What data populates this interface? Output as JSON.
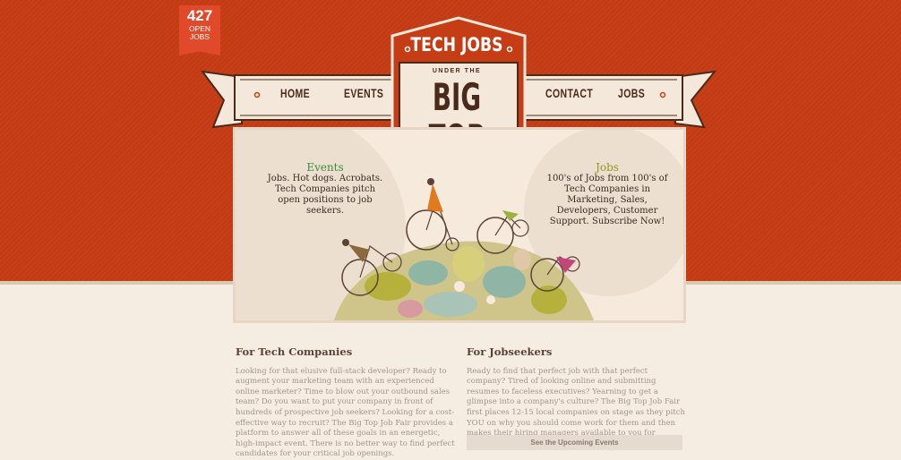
{
  "badge": {
    "count": "427",
    "line1": "OPEN",
    "line2": "JOBS"
  },
  "nav": {
    "home": "HOME",
    "events": "EVENTS",
    "contact": "CONTACT",
    "jobs": "JOBS"
  },
  "logo": {
    "top": "TECH JOBS",
    "middle": "UNDER THE",
    "big": "BIG TOP"
  },
  "hero": {
    "events": {
      "title": "Events",
      "text": "Jobs. Hot dogs. Acrobats. Tech Companies pitch open positions to job seekers."
    },
    "jobs": {
      "title": "Jobs",
      "text": "100's of Jobs from 100's of Tech Companies in Marketing, Sales, Developers, Customer Support. Subscribe Now!"
    }
  },
  "companies": {
    "heading": "For Tech Companies",
    "body": "Looking for that elusive full-stack developer? Ready to augment your marketing team with an experienced online marketer? Time to blow out your outbound sales team? Do you want to put your company in front of hundreds of prospective job seekers? Looking for a cost-effective way to recruit? The Big Top Job Fair provides a platform to answer all of these goals in an energetic, high-impact event. There is no better way to find perfect candidates for your critical job openings."
  },
  "jobseekers": {
    "heading": "For Jobseekers",
    "body": "Ready to find that perfect job with that perfect company? Tired of looking online and submitting resumes to faceless executives? Yearning to get a glimpse into a company's culture? The Big Top Job Fair first places 12-15 local companies on stage as they pitch YOU on why you should come work for them and then makes their hiring managers available to you for general networking.",
    "cta": "See the Upcoming Events"
  },
  "colors": {
    "brand_red": "#c63c14",
    "badge_red": "#e04a2a",
    "cream": "#f6ede2",
    "brown": "#4a2a1a"
  }
}
